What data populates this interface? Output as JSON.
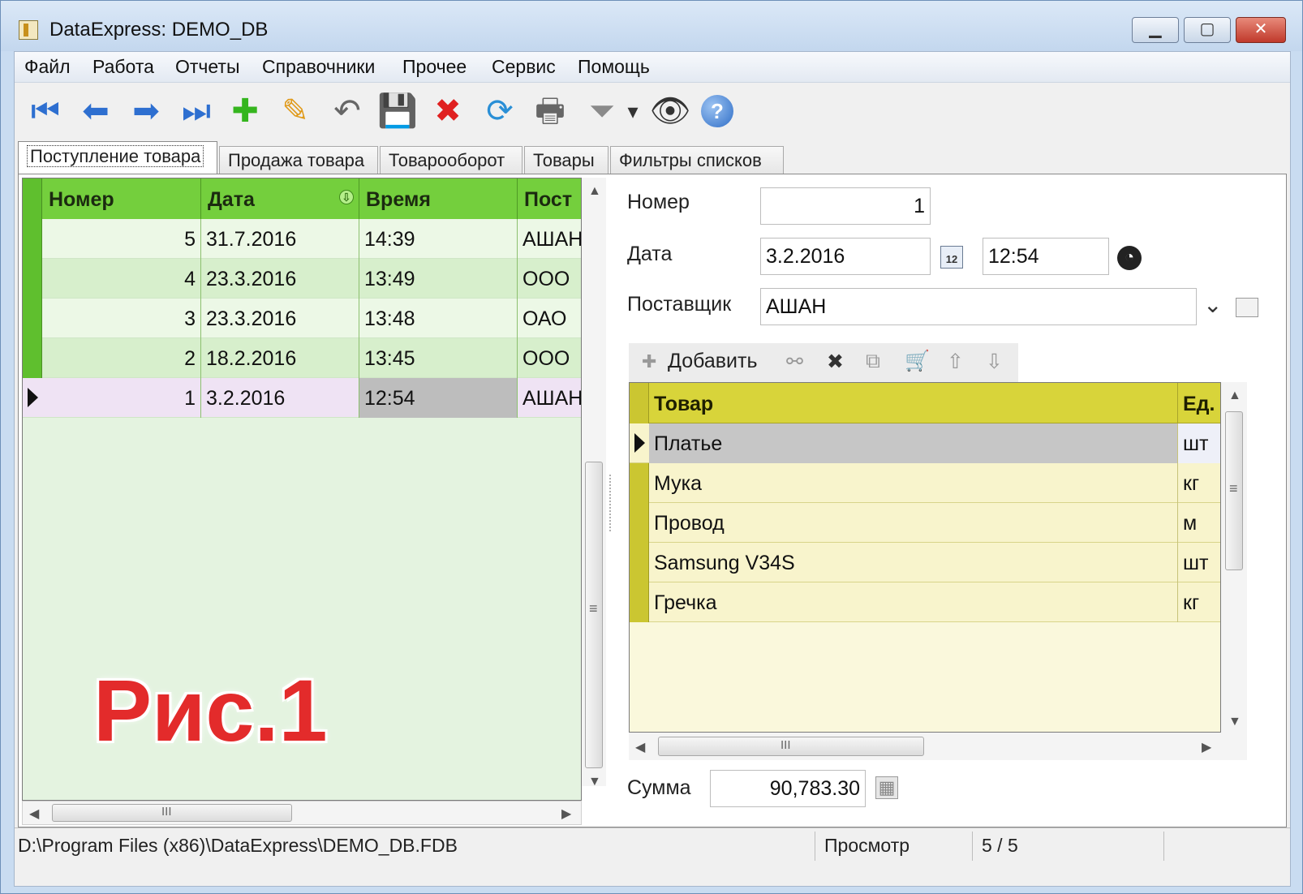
{
  "window": {
    "title": "DataExpress: DEMO_DB",
    "min_glyph": "▁",
    "max_glyph": "▢",
    "close_glyph": "✕"
  },
  "menu": [
    "Файл",
    "Работа",
    "Отчеты",
    "Справочники",
    "Прочее",
    "Сервис",
    "Помощь"
  ],
  "toolbar": {
    "icons": [
      {
        "name": "first-record-icon",
        "glyph": "⏮",
        "color": "#2e6fd0"
      },
      {
        "name": "prev-record-icon",
        "glyph": "⬅",
        "color": "#2e6fd0"
      },
      {
        "name": "next-record-icon",
        "glyph": "➡",
        "color": "#2e6fd0"
      },
      {
        "name": "last-record-icon",
        "glyph": "⏭",
        "color": "#2e6fd0"
      },
      {
        "name": "add-icon",
        "glyph": "✚",
        "color": "#35b51e"
      },
      {
        "name": "edit-pencil-icon",
        "glyph": "✎",
        "color": "#e09a1a"
      },
      {
        "name": "undo-icon",
        "glyph": "↶",
        "color": "#666666"
      },
      {
        "name": "save-icon",
        "glyph": "💾",
        "color": "#666666"
      },
      {
        "name": "delete-icon",
        "glyph": "✖",
        "color": "#e02020"
      },
      {
        "name": "refresh-icon",
        "glyph": "⟳",
        "color": "#2a8fd6"
      },
      {
        "name": "print-icon",
        "glyph": "🖶",
        "color": "#666666"
      },
      {
        "name": "filter-icon",
        "glyph": "⏷",
        "color": "#8a8a8a"
      },
      {
        "name": "filter-dropdown-icon",
        "glyph": "▾",
        "color": "#333333"
      },
      {
        "name": "find-binoculars-icon",
        "glyph": "👁",
        "color": "#333333"
      },
      {
        "name": "help-icon",
        "glyph": "?",
        "color": "#ffffff"
      }
    ]
  },
  "tabs": [
    "Поступление товара",
    "Продажа товара",
    "Товарооборот",
    "Товары",
    "Фильтры списков"
  ],
  "receipts_grid": {
    "columns": [
      "Номер",
      "Дата",
      "Время",
      "Пост"
    ],
    "rows": [
      {
        "number": "5",
        "date": "31.7.2016",
        "time": "14:39",
        "supplier": "АШАН"
      },
      {
        "number": "4",
        "date": "23.3.2016",
        "time": "13:49",
        "supplier": "ООО"
      },
      {
        "number": "3",
        "date": "23.3.2016",
        "time": "13:48",
        "supplier": "ОАО"
      },
      {
        "number": "2",
        "date": "18.2.2016",
        "time": "13:45",
        "supplier": "ООО"
      },
      {
        "number": "1",
        "date": "3.2.2016",
        "time": "12:54",
        "supplier": "АШАН"
      }
    ],
    "selected_row": 4
  },
  "watermark": "Рис.1",
  "form": {
    "number_label": "Номер",
    "number_value": "1",
    "date_label": "Дата",
    "date_value": "3.2.2016",
    "time_value": "12:54",
    "supplier_label": "Поставщик",
    "supplier_value": "АШАН",
    "calendar_glyph": "12",
    "clock_glyph": "◔",
    "dropdown_glyph": "⌄"
  },
  "detail_toolbar": {
    "add_label": "Добавить",
    "add_glyph": "✚",
    "find_glyph": "⚯",
    "delete_glyph": "✖",
    "copy_glyph": "⧉",
    "cart_glyph": "🛒",
    "up_glyph": "⇧",
    "down_glyph": "⇩"
  },
  "items_grid": {
    "columns": [
      "Товар",
      "Ед."
    ],
    "rows": [
      {
        "product": "Платье",
        "unit": "шт"
      },
      {
        "product": "Мука",
        "unit": "кг"
      },
      {
        "product": "Провод",
        "unit": "м"
      },
      {
        "product": "Samsung V34S",
        "unit": "шт"
      },
      {
        "product": "Гречка",
        "unit": "кг"
      }
    ],
    "selected_row": 0
  },
  "total": {
    "label": "Сумма",
    "value": "90,783.30",
    "calc_glyph": "▦"
  },
  "scroll_glyphs": {
    "up": "▲",
    "down": "▼",
    "left": "◀",
    "right": "▶",
    "grip_v": "≡",
    "grip_h": "III"
  },
  "statusbar": {
    "path": "D:\\Program Files (x86)\\DataExpress\\DEMO_DB.FDB",
    "mode": "Просмотр",
    "position": "5 / 5"
  }
}
